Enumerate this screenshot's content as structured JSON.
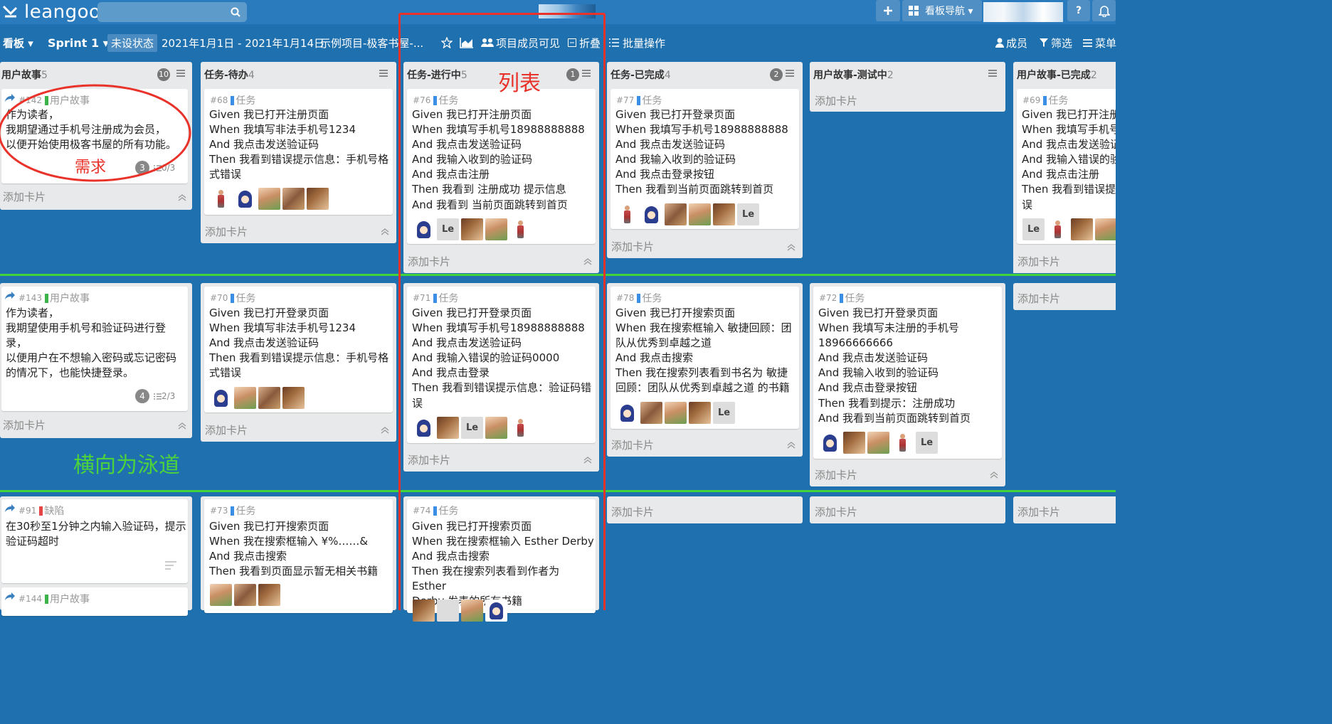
{
  "app": {
    "logo_text": "leangoo",
    "search_placeholder": "",
    "board_nav_label": "看板导航 ▾",
    "help_label": "?"
  },
  "board": {
    "view_label": "看板 ▾",
    "sprint_label": "Sprint 1 ▾",
    "status": "未设状态",
    "date_range": "2021年1月1日 - 2021年1月14日",
    "project": "示例项目-极客书屋-...",
    "visibility": "项目成员可见",
    "fold": "折叠",
    "batch": "批量操作",
    "members": "成员",
    "filter": "筛选",
    "menu": "菜单"
  },
  "add_card_label": "添加卡片",
  "columns": [
    {
      "title": "用户故事",
      "count": "5",
      "badge": "10"
    },
    {
      "title": "任务-待办",
      "count": "4",
      "badge": ""
    },
    {
      "title": "任务-进行中",
      "count": "5",
      "badge": "1"
    },
    {
      "title": "任务-已完成",
      "count": "4",
      "badge": "2"
    },
    {
      "title": "用户故事-测试中",
      "count": "2",
      "badge": ""
    },
    {
      "title": "用户故事-已完成",
      "count": "2",
      "badge": ""
    }
  ],
  "type_colors": {
    "story": "#3bb34a",
    "task": "#3a8ee6",
    "bug": "#e54545"
  },
  "cards": {
    "c142": {
      "num": "#142",
      "type": "用户故事",
      "lines": [
        "作为读者，",
        "我期望通过手机号注册成为会员，",
        "以便开始使用极客书屋的所有功能。"
      ],
      "comments": "3",
      "checklist": "0/3"
    },
    "c68": {
      "num": "#68",
      "type": "任务",
      "lines": [
        "Given 我已打开注册页面",
        "When 我填写非法手机号1234",
        "And 我点击发送验证码",
        "Then 我看到错误提示信息：手机号格",
        "式错误"
      ]
    },
    "c76": {
      "num": "#76",
      "type": "任务",
      "lines": [
        "Given 我已打开注册页面",
        "When 我填写手机号18988888888",
        "And 我点击发送验证码",
        "And 我输入收到的验证码",
        "And 我点击注册",
        "Then 我看到 注册成功 提示信息",
        "And 我看到 当前页面跳转到首页"
      ]
    },
    "c77": {
      "num": "#77",
      "type": "任务",
      "lines": [
        "Given 我已打开登录页面",
        "When 我填写手机号18988888888",
        "And 我点击发送验证码",
        "And 我输入收到的验证码",
        "And 我点击登录按钮",
        "Then 我看到当前页面跳转到首页"
      ]
    },
    "c69": {
      "num": "#69",
      "type": "任务",
      "lines": [
        "Given 我已打开注册",
        "When 我填写手机号",
        "And 我点击发送验证",
        "And 我输入错误的验",
        "And 我点击注册",
        "Then 我看到错误提示",
        "误"
      ]
    },
    "c143": {
      "num": "#143",
      "type": "用户故事",
      "lines": [
        "作为读者，",
        "我期望使用手机号和验证码进行登",
        "录，",
        "以便用户在不想输入密码或忘记密码",
        "的情况下，也能快捷登录。"
      ],
      "comments": "4",
      "checklist": "2/3"
    },
    "c70": {
      "num": "#70",
      "type": "任务",
      "lines": [
        "Given 我已打开登录页面",
        "When 我填写非法手机号1234",
        "And 我点击发送验证码",
        "Then 我看到错误提示信息：手机号格",
        "式错误"
      ]
    },
    "c71": {
      "num": "#71",
      "type": "任务",
      "lines": [
        "Given 我已打开登录页面",
        "When 我填写手机号18988888888",
        "And 我点击发送验证码",
        "And 我输入错误的验证码0000",
        "And 我点击登录",
        "Then 我看到错误提示信息：验证码错",
        "误"
      ]
    },
    "c78": {
      "num": "#78",
      "type": "任务",
      "lines": [
        "Given 我已打开搜索页面",
        "When 我在搜索框输入 敏捷回顾：团",
        "队从优秀到卓越之道",
        "And 我点击搜索",
        "Then 我在搜索列表看到书名为 敏捷",
        "回顾：团队从优秀到卓越之道 的书籍"
      ]
    },
    "c72": {
      "num": "#72",
      "type": "任务",
      "lines": [
        "Given 我已打开登录页面",
        "When 我填写未注册的手机号",
        "18966666666",
        "And 我点击发送验证码",
        "And 我输入收到的验证码",
        "And 我点击登录按钮",
        "Then 我看到提示：注册成功",
        "And 我看到当前页面跳转到首页"
      ]
    },
    "c91": {
      "num": "#91",
      "type": "缺陷",
      "lines": [
        "在30秒至1分钟之内输入验证码，提示",
        "验证码超时"
      ]
    },
    "c144": {
      "num": "#144",
      "type": "用户故事",
      "lines": []
    },
    "c73": {
      "num": "#73",
      "type": "任务",
      "lines": [
        "Given 我已打开搜索页面",
        "When 我在搜索框输入 ¥%……&",
        "And 我点击搜索",
        "Then 我看到页面显示暂无相关书籍"
      ]
    },
    "c74": {
      "num": "#74",
      "type": "任务",
      "lines": [
        "Given 我已打开搜索页面",
        "When 我在搜索框输入 Esther Derby",
        "And 我点击搜索",
        "Then 我在搜索列表看到作者为 Esther",
        "Derby 发表的所有书籍"
      ]
    }
  },
  "annotations": {
    "requirement": "需求",
    "list": "列表",
    "swimlane": "横向为泳道"
  },
  "colors": {
    "background": "#1f70ae",
    "annotation_red": "#e8322a",
    "annotation_green": "#42d43a"
  }
}
